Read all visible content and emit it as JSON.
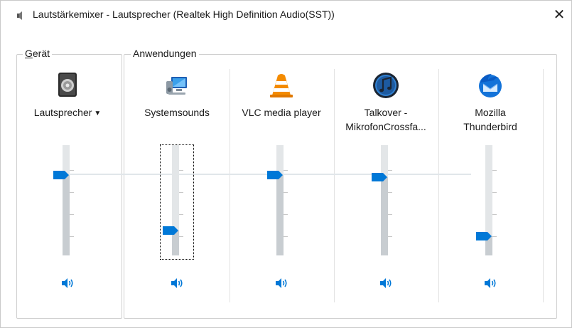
{
  "window": {
    "title": "Lautstärkemixer - Lautsprecher (Realtek High Definition Audio(SST))",
    "close_glyph": "✕"
  },
  "groups": {
    "device_label_first": "G",
    "device_label_rest": "erät",
    "apps_label": "Anwendungen"
  },
  "device": {
    "name": "Lautsprecher",
    "dropdown_glyph": "▼",
    "icon": "speaker-device-icon",
    "volume_percent": 75,
    "mute_icon": "speaker-volume-icon"
  },
  "applications": [
    {
      "name": "Systemsounds",
      "icon": "system-sounds-icon",
      "volume_percent": 20,
      "relative_peak_percent": 75,
      "mute_icon": "speaker-volume-icon",
      "focused": true
    },
    {
      "name": "VLC media player",
      "icon": "vlc-cone-icon",
      "volume_percent": 75,
      "mute_icon": "speaker-volume-icon",
      "focused": false
    },
    {
      "name": "Talkover -\nMikrofonCrossfa...",
      "icon": "talkover-music-icon",
      "volume_percent": 73,
      "mute_icon": "speaker-volume-icon",
      "focused": false
    },
    {
      "name": "Mozilla\nThunderbird",
      "icon": "thunderbird-icon",
      "volume_percent": 15,
      "mute_icon": "speaker-volume-icon",
      "focused": false
    }
  ],
  "colors": {
    "accent": "#0078d7",
    "track": "#e3e6e8",
    "peak_line": "#e1e6ea"
  }
}
